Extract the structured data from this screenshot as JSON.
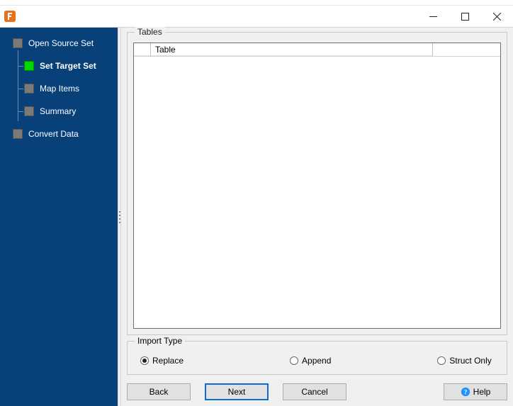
{
  "titlebar": {
    "app_icon_name": "app-icon"
  },
  "sidebar": {
    "items": [
      {
        "label": "Open Source Set",
        "level": 0,
        "active": false,
        "has_children": true
      },
      {
        "label": "Set Target Set",
        "level": 1,
        "active": true,
        "bold": true
      },
      {
        "label": "Map Items",
        "level": 1,
        "active": false
      },
      {
        "label": "Summary",
        "level": 1,
        "active": false
      },
      {
        "label": "Convert Data",
        "level": 0,
        "active": false
      }
    ]
  },
  "tables": {
    "legend": "Tables",
    "columns": {
      "check": "",
      "name": "Table"
    }
  },
  "import": {
    "legend": "Import Type",
    "options": [
      {
        "label": "Replace",
        "selected": true
      },
      {
        "label": "Append",
        "selected": false
      },
      {
        "label": "Struct Only",
        "selected": false
      }
    ]
  },
  "buttons": {
    "back": "Back",
    "next": "Next",
    "cancel": "Cancel",
    "help": "Help"
  }
}
